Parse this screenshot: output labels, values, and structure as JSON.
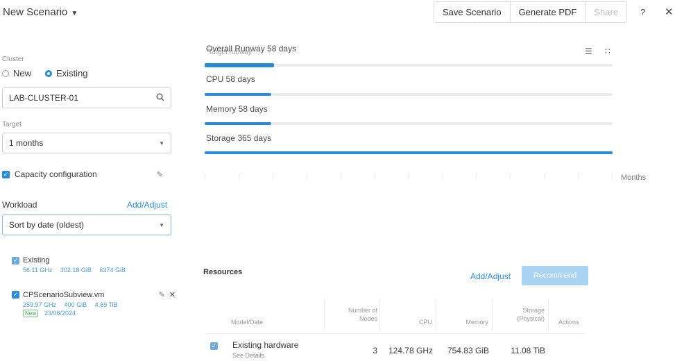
{
  "header": {
    "title": "New Scenario",
    "buttons": {
      "save": "Save Scenario",
      "pdf": "Generate PDF",
      "share": "Share"
    },
    "help": "?",
    "close": "✕"
  },
  "left": {
    "cluster_label": "Cluster",
    "cluster_options": {
      "new": "New",
      "existing": "Existing",
      "selected": "Existing"
    },
    "cluster_value": "LAB-CLUSTER-01",
    "target_label": "Target",
    "target_value": "1 months",
    "capacity_config_label": "Capacity configuration",
    "workload_label": "Workload",
    "workload_add": "Add/Adjust",
    "sort_value": "Sort by date (oldest)",
    "workloads": [
      {
        "name": "Existing",
        "cpu": "56.11 GHz",
        "memory": "302.18 GiB",
        "storage": "6374 GiB"
      },
      {
        "name": "CPScenarioSubview.vm",
        "cpu": "259.97 GHz",
        "memory": "400 GiB",
        "storage": "4.69 TiB",
        "badge": "New",
        "date": "23/06/2024"
      }
    ]
  },
  "runway": {
    "ghost_label": "Target runway",
    "rows": [
      {
        "label": "Overall Runway 58 days",
        "fill_fraction": 0.17
      },
      {
        "label": "CPU 58 days",
        "fill_fraction": 0.163
      },
      {
        "label": "Memory 58 days",
        "fill_fraction": 0.163
      },
      {
        "label": "Storage 365 days",
        "fill_fraction": 1.0
      }
    ],
    "axis_label": "Months",
    "icons": {
      "list": "list-view-icon",
      "grid": "grid-view-icon"
    }
  },
  "resources": {
    "title": "Resources",
    "add_label": "Add/Adjust",
    "recommend_label": "Recommend",
    "columns": {
      "model": "Model/Date",
      "nodes": [
        "Number of",
        "Nodes"
      ],
      "cpu": "CPU",
      "memory": "Memory",
      "storage": [
        "Storage",
        "(Physical)"
      ],
      "actions": "Actions"
    },
    "rows": [
      {
        "model": "Existing hardware",
        "link": "See Details",
        "nodes": "3",
        "cpu": "124.78 GHz",
        "memory": "754.83 GiB",
        "storage": "11.08 TiB"
      }
    ]
  }
}
